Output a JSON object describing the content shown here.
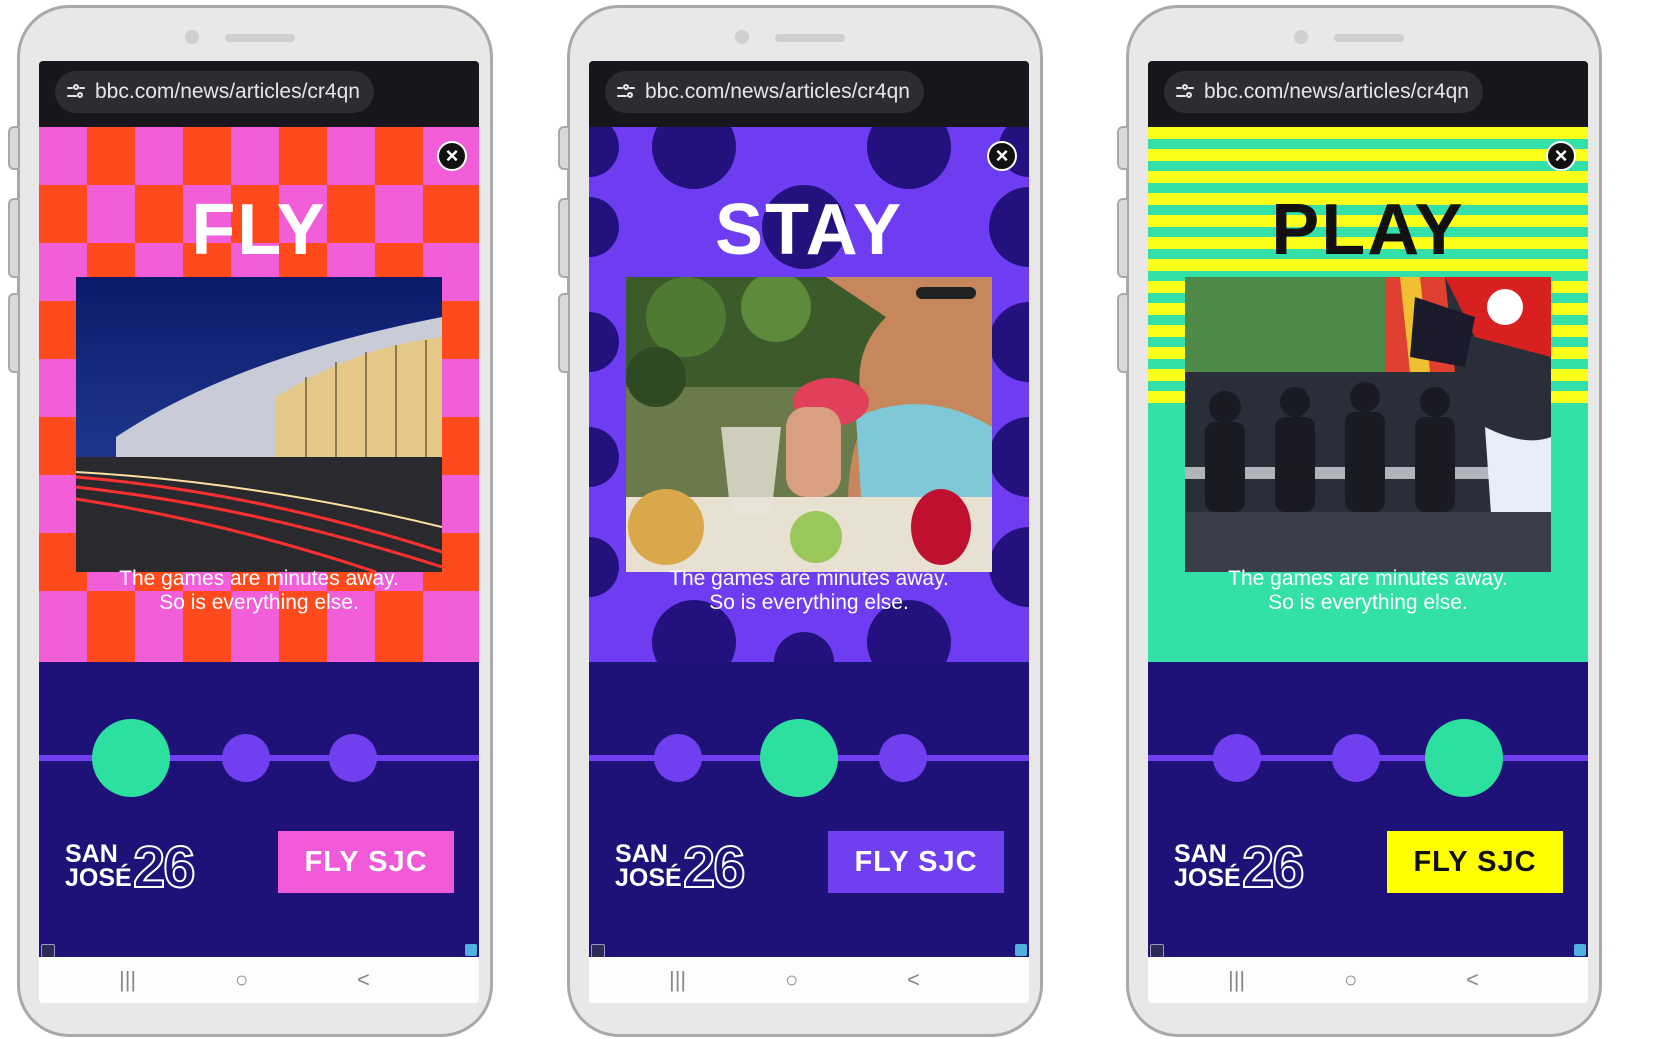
{
  "url": "bbc.com/news/articles/cr4qn",
  "tagline_line1": "The games are minutes away.",
  "tagline_line2": "So is everything else.",
  "logo": {
    "line1": "SAN",
    "line2": "JOSÉ",
    "year": "26"
  },
  "cta_label": "FLY SJC",
  "nav": {
    "recents": "|||",
    "home": "○",
    "back": "<"
  },
  "colors": {
    "promo_bg": "#1e1177",
    "track": "#7040f0",
    "active_dot": "#2ee0a0"
  },
  "slides": [
    {
      "headline": "FLY",
      "active_index": 0,
      "headline_color": "#ffffff",
      "cta_bg": "#f05ad8",
      "cta_color": "#ffffff",
      "theme": "checkerboard pink/red",
      "photo": "airport terminal at night"
    },
    {
      "headline": "STAY",
      "active_index": 1,
      "headline_color": "#ffffff",
      "cta_bg": "#7040f0",
      "cta_color": "#ffffff",
      "theme": "purple with navy dots",
      "photo": "diner raising a drink"
    },
    {
      "headline": "PLAY",
      "active_index": 2,
      "headline_color": "#111111",
      "cta_bg": "#ffff00",
      "cta_color": "#111111",
      "theme": "yellow/mint stripes",
      "photo": "soccer fans in stadium"
    }
  ]
}
